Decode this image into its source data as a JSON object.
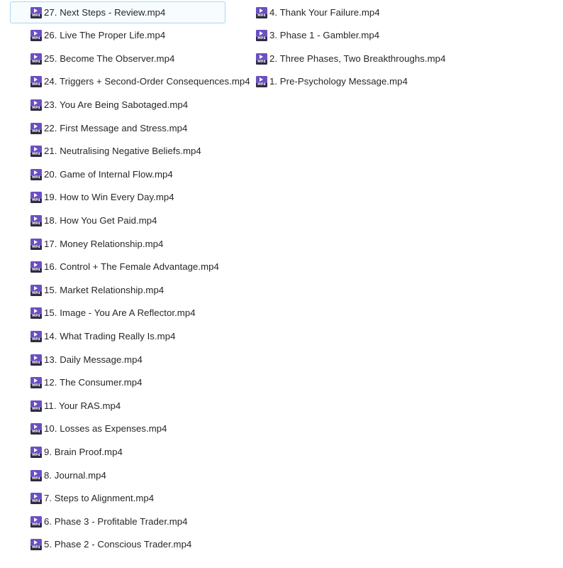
{
  "view": {
    "name": "file-explorer-list-view",
    "background_color": "#ffffff",
    "text_color": "#26262a",
    "selection_border_color": "#a9d8ef",
    "selection_fill_color": "#f7fcfe",
    "icon_color": "#6b4fc4",
    "icon_strip_color": "#2f2b40",
    "icon_label": "MP4",
    "icon_name": "mp4-video-file-icon",
    "row_height": 32.6
  },
  "columns": [
    {
      "id": "column-left",
      "name": "file-column-left",
      "items": [
        {
          "label": "27. Next Steps - Review.mp4",
          "selected": true
        },
        {
          "label": "26. Live The Proper Life.mp4",
          "selected": false
        },
        {
          "label": "25. Become The Observer.mp4",
          "selected": false
        },
        {
          "label": "24. Triggers + Second-Order Consequences.mp4",
          "selected": false
        },
        {
          "label": "23. You Are Being Sabotaged.mp4",
          "selected": false
        },
        {
          "label": "22. First Message and Stress.mp4",
          "selected": false
        },
        {
          "label": "21. Neutralising Negative Beliefs.mp4",
          "selected": false
        },
        {
          "label": "20. Game of Internal Flow.mp4",
          "selected": false
        },
        {
          "label": "19. How to Win Every Day.mp4",
          "selected": false
        },
        {
          "label": "18. How You Get Paid.mp4",
          "selected": false
        },
        {
          "label": "17. Money Relationship.mp4",
          "selected": false
        },
        {
          "label": "16. Control + The Female Advantage.mp4",
          "selected": false
        },
        {
          "label": "15. Market Relationship.mp4",
          "selected": false
        },
        {
          "label": "15. Image - You Are A Reflector.mp4",
          "selected": false
        },
        {
          "label": "14. What Trading Really Is.mp4",
          "selected": false
        },
        {
          "label": "13. Daily Message.mp4",
          "selected": false
        },
        {
          "label": "12. The Consumer.mp4",
          "selected": false
        },
        {
          "label": "11. Your RAS.mp4",
          "selected": false
        },
        {
          "label": "10. Losses as Expenses.mp4",
          "selected": false
        },
        {
          "label": "9. Brain Proof.mp4",
          "selected": false
        },
        {
          "label": "8. Journal.mp4",
          "selected": false
        },
        {
          "label": "7. Steps to Alignment.mp4",
          "selected": false
        },
        {
          "label": "6. Phase 3 - Profitable Trader.mp4",
          "selected": false
        },
        {
          "label": "5. Phase 2 - Conscious Trader.mp4",
          "selected": false
        }
      ]
    },
    {
      "id": "column-right",
      "name": "file-column-right",
      "items": [
        {
          "label": "4. Thank Your Failure.mp4",
          "selected": false
        },
        {
          "label": "3. Phase 1 - Gambler.mp4",
          "selected": false
        },
        {
          "label": "2. Three Phases, Two Breakthroughs.mp4",
          "selected": false
        },
        {
          "label": "1. Pre-Psychology Message.mp4",
          "selected": false
        }
      ]
    }
  ]
}
